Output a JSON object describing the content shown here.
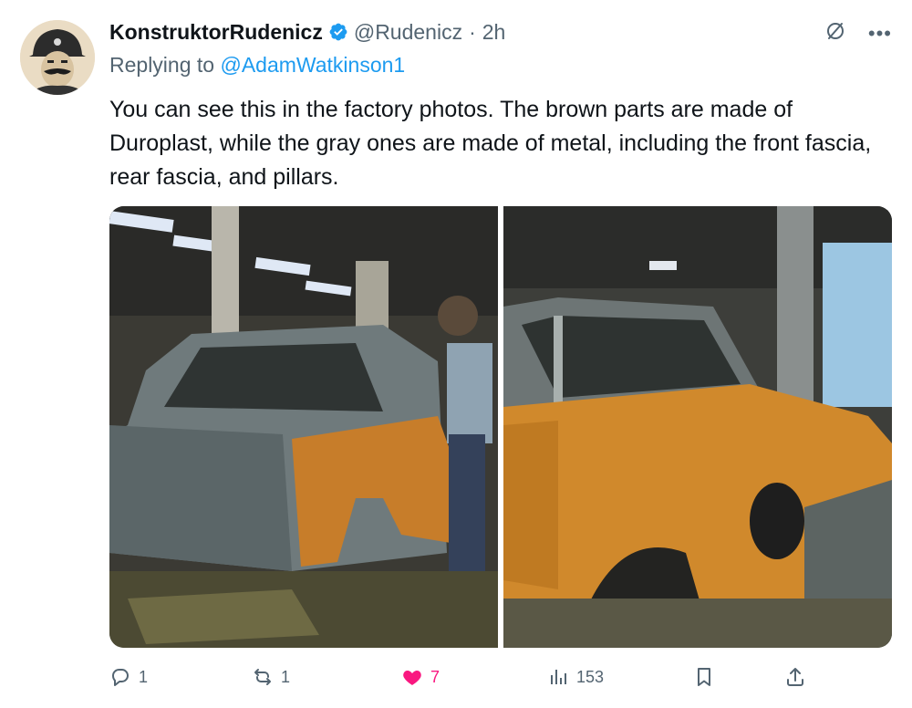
{
  "author": {
    "display_name": "KonstruktorRudenicz",
    "handle": "@Rudenicz",
    "separator": "·",
    "time": "2h"
  },
  "reply": {
    "prefix": "Replying to",
    "mention": "@AdamWatkinson1"
  },
  "tweet": {
    "text": "You can see this in the factory photos. The brown parts are made of Duroplast, while the gray ones are made of metal, including the front fascia, rear fascia, and pillars."
  },
  "media": {
    "images": [
      {
        "icon": "factory-photo-car-body-rear"
      },
      {
        "icon": "factory-photo-car-body-front"
      }
    ]
  },
  "actions": {
    "replies": "1",
    "reposts": "1",
    "likes": "7",
    "views": "153"
  },
  "colors": {
    "accent": "#1d9bf0",
    "like": "#f91880",
    "muted": "#536471",
    "text": "#0f1419"
  }
}
